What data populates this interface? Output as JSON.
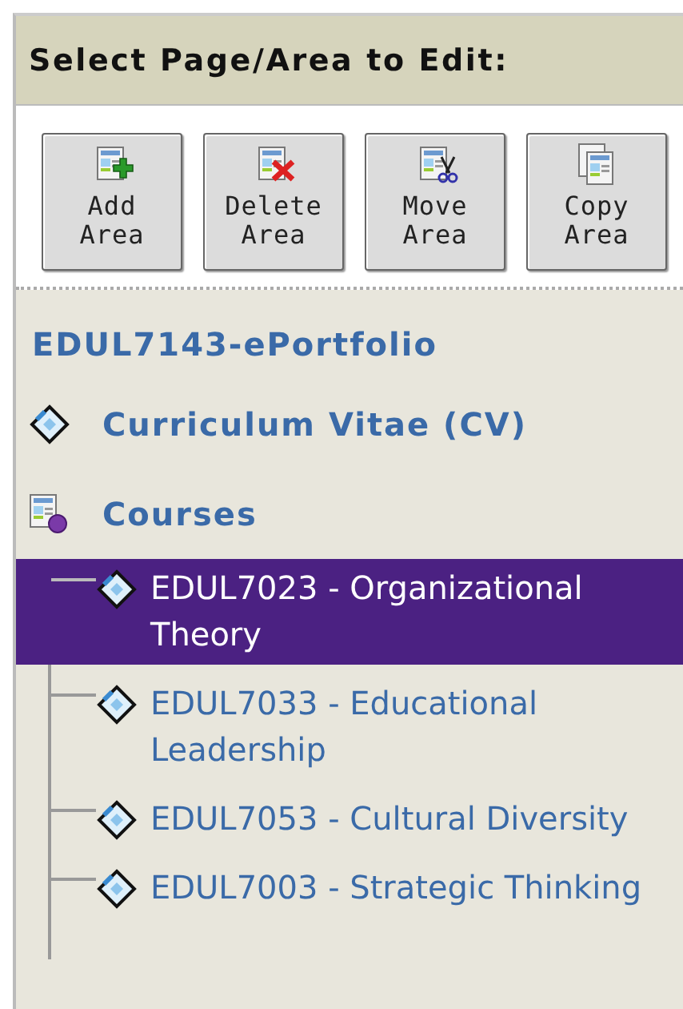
{
  "header": {
    "title": "Select Page/Area to Edit:"
  },
  "toolbar": [
    {
      "kind": "add",
      "label": "Add\nArea"
    },
    {
      "kind": "delete",
      "label": "Delete\nArea"
    },
    {
      "kind": "move",
      "label": "Move\nArea"
    },
    {
      "kind": "copy",
      "label": "Copy\nArea"
    }
  ],
  "tree": {
    "title": "EDUL7143-ePortfolio",
    "items": [
      {
        "kind": "page",
        "label": "Curriculum Vitae (CV)",
        "selected": false
      },
      {
        "kind": "folder",
        "label": "Courses",
        "selected": false,
        "children": [
          {
            "kind": "page",
            "label": "EDUL7023 - Organizational Theory",
            "selected": true
          },
          {
            "kind": "page",
            "label": "EDUL7033 - Educational Leadership",
            "selected": false
          },
          {
            "kind": "page",
            "label": "EDUL7053 - Cultural Diversity",
            "selected": false
          },
          {
            "kind": "page",
            "label": "EDUL7003 - Strategic Thinking",
            "selected": false
          }
        ]
      }
    ]
  }
}
